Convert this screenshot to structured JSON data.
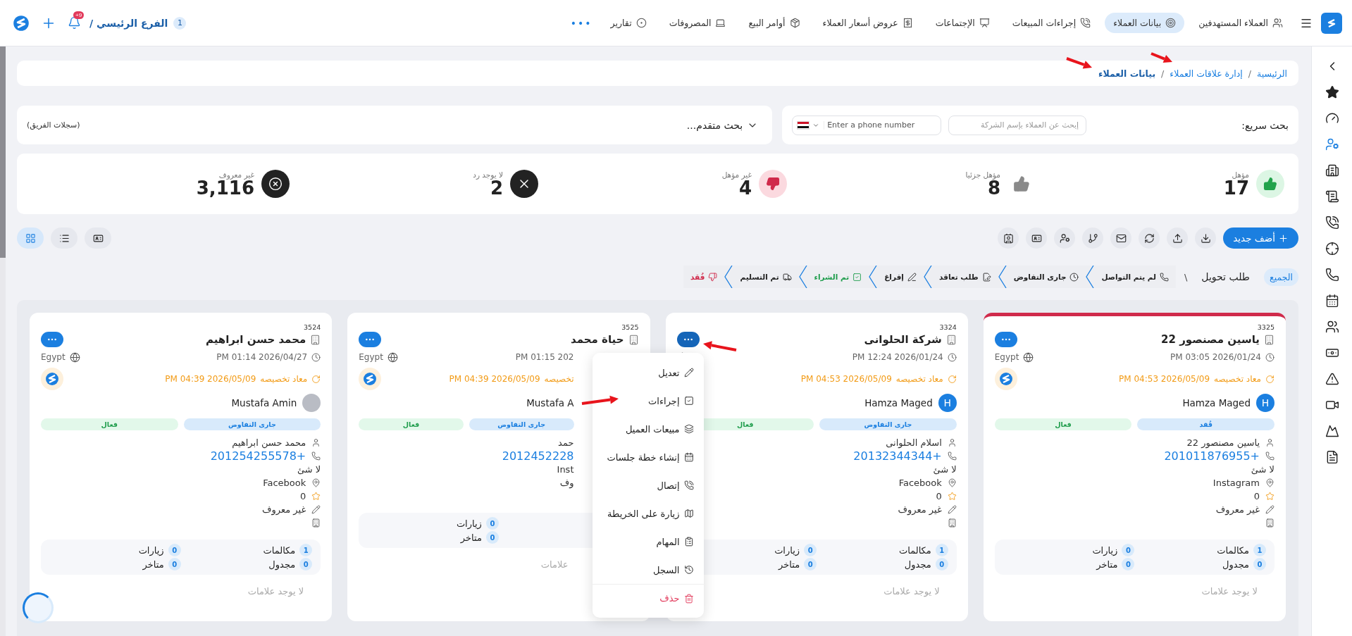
{
  "topbar": {
    "nav": [
      {
        "label": "العملاء المستهدفين",
        "selected": false
      },
      {
        "label": "بيانات العملاء",
        "selected": true
      },
      {
        "label": "إجراءات المبيعات",
        "selected": false
      },
      {
        "label": "الإجتماعات",
        "selected": false
      },
      {
        "label": "عروض أسعار العملاء",
        "selected": false
      },
      {
        "label": "أوامر البيع",
        "selected": false
      },
      {
        "label": "المصروفات",
        "selected": false
      },
      {
        "label": "تقارير",
        "selected": false
      }
    ],
    "more": "•••",
    "branch_count": "1",
    "branch": "الفرع الرئيسي /",
    "notifications": "+9"
  },
  "sidebar": {
    "items": [
      {
        "selected": false
      },
      {
        "selected": false
      },
      {
        "selected": false
      },
      {
        "selected": true
      },
      {
        "selected": false
      },
      {
        "selected": false
      },
      {
        "selected": false
      },
      {
        "selected": false
      },
      {
        "selected": false
      },
      {
        "selected": false
      },
      {
        "selected": false
      },
      {
        "selected": false
      },
      {
        "selected": false
      },
      {
        "selected": false
      },
      {
        "selected": false
      },
      {
        "selected": false
      }
    ]
  },
  "breadcrumb": [
    {
      "label": "الرئيسية",
      "current": false
    },
    {
      "label": "إدارة علاقات العملاء",
      "current": false
    },
    {
      "label": "بيانات العملاء",
      "current": true
    }
  ],
  "breadcrumb_separator": "/",
  "search": {
    "label": "بحث سريع:",
    "company_placeholder": "إبحث عن العملاء بإسم الشركة",
    "phone_placeholder": "Enter a phone number",
    "advanced": "بحث متقدم...",
    "team": "(سجلات الفريق)"
  },
  "stats": [
    {
      "kind": "qualified",
      "label": "مؤهل",
      "value": "17"
    },
    {
      "kind": "partial",
      "label": "مؤهل جزئيا",
      "value": "8"
    },
    {
      "kind": "unqualified",
      "label": "غير مؤهل",
      "value": "4"
    },
    {
      "kind": "no_reply",
      "label": "لا يوجد رد",
      "value": "2"
    },
    {
      "kind": "unknown",
      "label": "غير معروف",
      "value": "3,116"
    }
  ],
  "toolbar": {
    "add": "أضف جديد",
    "views": [
      {
        "selected": true
      },
      {
        "selected": false
      },
      {
        "selected": false
      }
    ]
  },
  "filters": [
    {
      "label": "الجميع",
      "selected": true
    },
    {
      "label": "طلب تحويل",
      "selected": false
    }
  ],
  "filter_separator": "\\",
  "stages": [
    {
      "label": "لم يتم التواصل",
      "kind": "normal"
    },
    {
      "label": "جارى التفاوض",
      "kind": "normal"
    },
    {
      "label": "طلب تعاقد",
      "kind": "normal"
    },
    {
      "label": "إفراغ",
      "kind": "normal"
    },
    {
      "label": "تم الشراء",
      "kind": "success"
    },
    {
      "label": "تم التسليم",
      "kind": "normal"
    },
    {
      "label": "فُقد",
      "kind": "danger"
    }
  ],
  "cards": [
    {
      "id": "3325",
      "name": "ياسين مصنصور 22",
      "selected": true,
      "partly_hidden": false,
      "created": "PM 03:05 2026/01/24",
      "country": "Egypt",
      "brand_logo": true,
      "appointment_label": "معاد تخصيصه",
      "appointment_time": "PM 04:53 2026/05/09",
      "user": {
        "kind": "letter",
        "letter": "H",
        "name": "Hamza Maged"
      },
      "stage": "فُقد",
      "status": "فعال",
      "contact": "ياسين مصنصور 22",
      "phone": "+201011876955",
      "note": "لا شئ",
      "source": "Instagram",
      "rating": "0",
      "classification": "غير معروف",
      "counts": [
        {
          "label": "مكالمات",
          "count": "1"
        },
        {
          "label": "زيارات",
          "count": "0"
        },
        {
          "label": "مجدول",
          "count": "0"
        },
        {
          "label": "متاخر",
          "count": "0"
        }
      ],
      "labels_note": "لا يوجد علامات",
      "menu_open": false
    },
    {
      "id": "3324",
      "name": "شركة الحلوانى",
      "selected": false,
      "partly_hidden": false,
      "created": "PM 12:24 2026/01/24",
      "brand_logo": false,
      "appointment_label": "معاد تخصيصه",
      "appointment_time": "PM 04:53 2026/05/09",
      "user": {
        "kind": "letter",
        "letter": "H",
        "name": "Hamza Maged"
      },
      "stage": "جارى التفاوض",
      "status": "فعال",
      "contact": "اسلام الحلوانى",
      "phone": "+20132344344",
      "note": "لا شئ",
      "source": "Facebook",
      "rating": "0",
      "classification": "غير معروف",
      "counts": [
        {
          "label": "مكالمات",
          "count": "1"
        },
        {
          "label": "زيارات",
          "count": "0"
        },
        {
          "label": "مجدول",
          "count": "0"
        },
        {
          "label": "متاخر",
          "count": "0"
        }
      ],
      "labels_note": "لا يوجد علامات",
      "menu_open": true,
      "menu": [
        {
          "label": "تعديل",
          "kind": "normal"
        },
        {
          "label": "إجراءات",
          "kind": "normal"
        },
        {
          "label": "مبيعات العميل",
          "kind": "normal"
        },
        {
          "label": "إنشاء خطة جلسات",
          "kind": "normal"
        },
        {
          "label": "إتصال",
          "kind": "normal"
        },
        {
          "label": "زيارة على الخريطة",
          "kind": "normal"
        },
        {
          "label": "المهام",
          "kind": "normal"
        },
        {
          "label": "السجل",
          "kind": "normal"
        },
        {
          "label": "حذف",
          "kind": "danger"
        }
      ]
    },
    {
      "id": "3525",
      "name": "حياة محمد",
      "selected": false,
      "partly_hidden": true,
      "created": "PM 01:15 202",
      "country": "Egypt",
      "brand_logo": true,
      "appointment_label": "تخصيصه",
      "appointment_time": "PM 04:39 2026/05/09",
      "user": {
        "name": "Mustafa A"
      },
      "stage": "جارى التفاوض",
      "status": "فعال",
      "contact": "حمد",
      "phone": "2012452228",
      "source": "Inst",
      "classification": "وف",
      "counts": [
        {
          "label": "زيارات",
          "count": "0"
        },
        {
          "label": "متاخر",
          "count": "0"
        }
      ],
      "labels_note": "علامات",
      "menu_open": false
    },
    {
      "id": "3524",
      "name": "محمد حسن ابراهيم",
      "selected": false,
      "partly_hidden": false,
      "created": "PM 01:14 2026/04/27",
      "country": "Egypt",
      "brand_logo": true,
      "appointment_label": "معاد تخصيصه",
      "appointment_time": "PM 04:39 2026/05/09",
      "user": {
        "kind": "photo",
        "name": "Mustafa Amin"
      },
      "stage": "جارى التفاوض",
      "status": "فعال",
      "contact": "محمد حسن ابراهيم",
      "phone": "+201254255578",
      "note": "لا شئ",
      "source": "Facebook",
      "rating": "0",
      "classification": "غير معروف",
      "counts": [
        {
          "label": "مكالمات",
          "count": "1"
        },
        {
          "label": "زيارات",
          "count": "0"
        },
        {
          "label": "مجدول",
          "count": "0"
        },
        {
          "label": "متاخر",
          "count": "0"
        }
      ],
      "labels_note": "لا يوجد علامات",
      "menu_open": false
    }
  ]
}
